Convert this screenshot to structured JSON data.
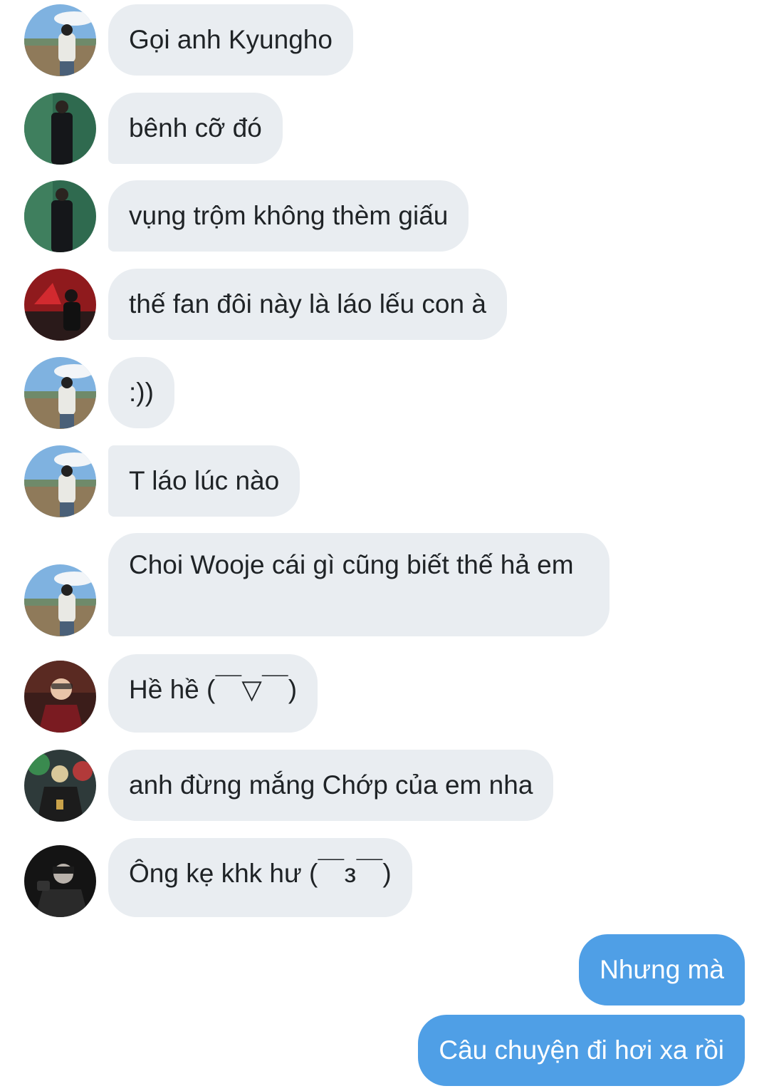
{
  "messages": [
    {
      "text": "Gọi anh Kyungho",
      "avatar": "avatar-field-photo"
    },
    {
      "text": "bênh cỡ đó",
      "avatar": "avatar-suit-photo"
    },
    {
      "text": "vụng trộm không thèm giấu",
      "avatar": "avatar-suit-photo"
    },
    {
      "text": "thế fan đôi này là láo lếu con à",
      "avatar": "avatar-red-fan-photo"
    },
    {
      "text": ":))",
      "avatar": "avatar-field-photo"
    },
    {
      "text": "T láo lúc nào",
      "avatar": "avatar-field-photo"
    },
    {
      "text": "Choi Wooje cái gì cũng biết thế hả em",
      "avatar": "avatar-field-photo"
    },
    {
      "text": "Hề hề (￣▽￣)",
      "avatar": "avatar-glasses-photo"
    },
    {
      "text": "anh đừng mắng Chớp của em nha",
      "avatar": "avatar-jacket-photo"
    },
    {
      "text": "Ông kẹ khk hư (￣з￣)",
      "avatar": "avatar-dark-photo"
    }
  ],
  "own_messages": [
    {
      "text": "Nhưng mà"
    },
    {
      "text": "Câu chuyện đi hơi xa rồi"
    }
  ],
  "colors": {
    "incoming_bubble": "#e9edf1",
    "outgoing_bubble": "#4f9fe6",
    "incoming_text": "#1f2326",
    "outgoing_text": "#ffffff"
  }
}
